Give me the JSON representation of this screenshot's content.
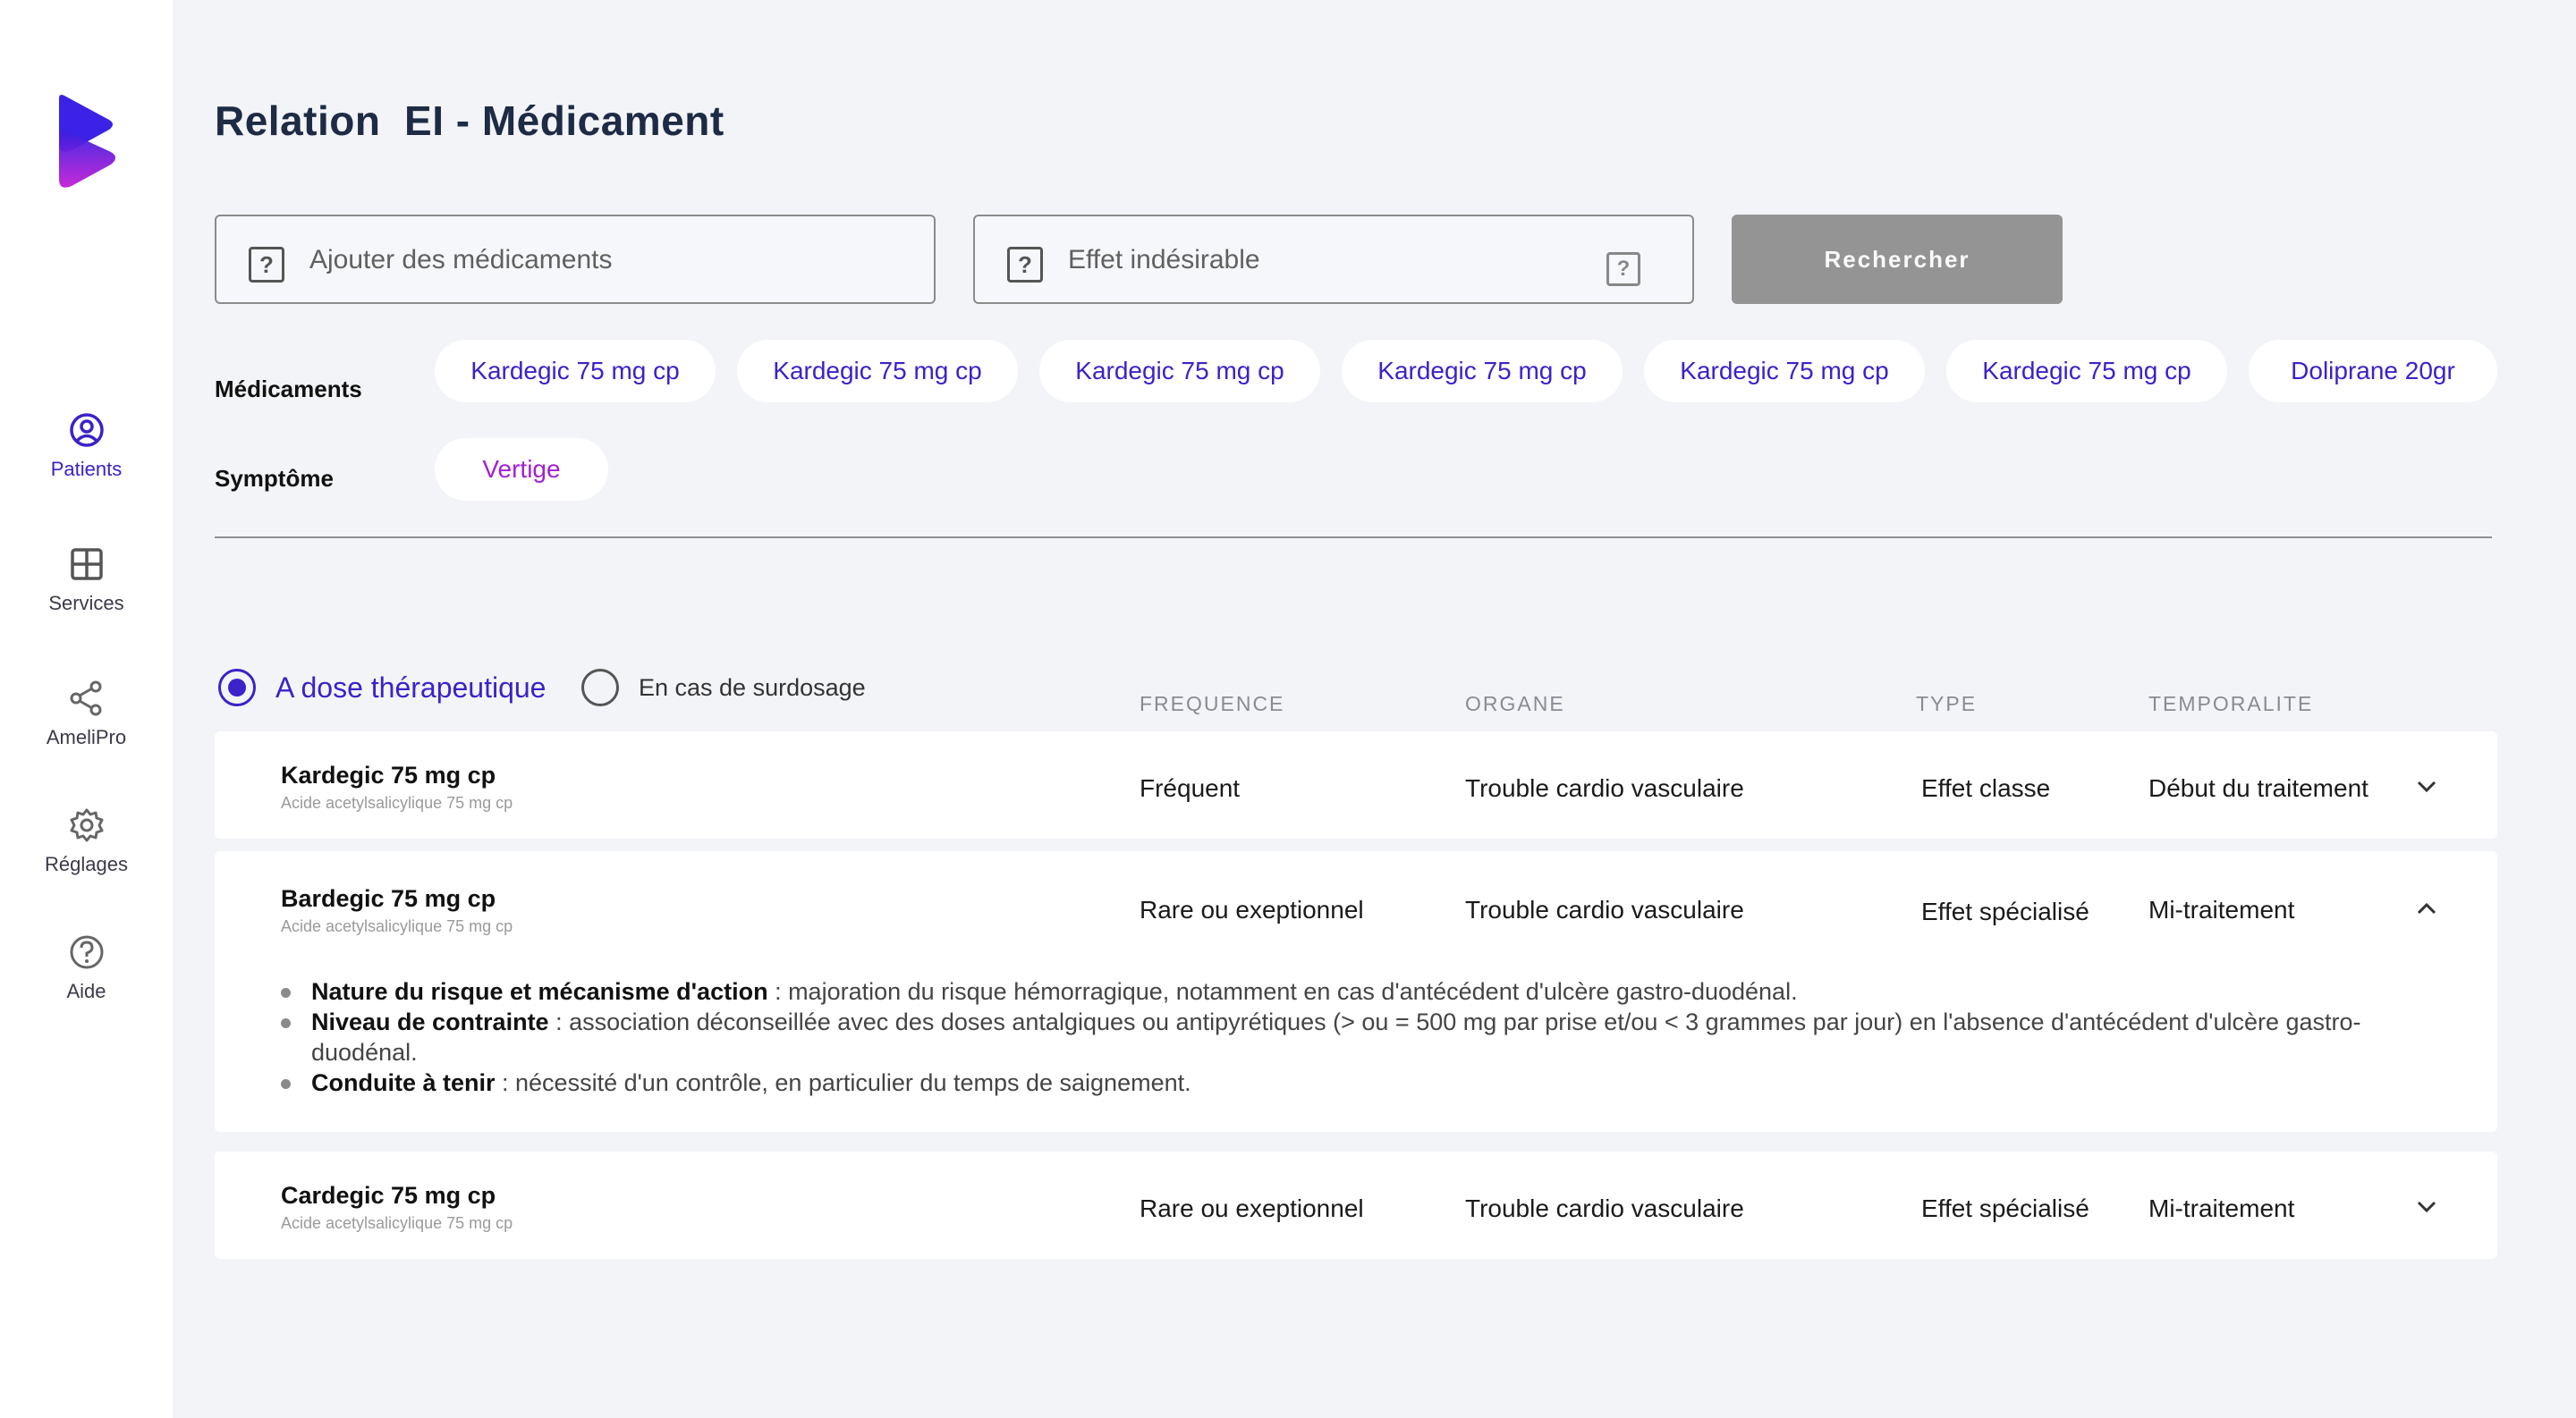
{
  "sidebar": {
    "logo_icon": "brand-logo",
    "items": [
      {
        "label": "Patients",
        "icon": "user-circle-icon",
        "active": true
      },
      {
        "label": "Services",
        "icon": "grid-icon",
        "active": false
      },
      {
        "label": "AmeliPro",
        "icon": "share-icon",
        "active": false
      },
      {
        "label": "Réglages",
        "icon": "gear-icon",
        "active": false
      },
      {
        "label": "Aide",
        "icon": "help-circle-icon",
        "active": false
      }
    ]
  },
  "page": {
    "title": "Relation  EI - Médicament"
  },
  "search": {
    "drug_placeholder": "Ajouter des médicaments",
    "effect_placeholder": "Effet indésirable",
    "help_glyph": "?",
    "button_label": "Rechercher"
  },
  "filters": {
    "drugs_label": "Médicaments",
    "drugs": [
      "Kardegic 75 mg cp",
      "Kardegic 75 mg cp",
      "Kardegic 75 mg cp",
      "Kardegic 75 mg cp",
      "Kardegic 75 mg cp",
      "Kardegic 75 mg cp",
      "Doliprane 20gr"
    ],
    "symptom_label": "Symptôme",
    "symptoms": [
      "Vertige"
    ]
  },
  "dose_options": {
    "therapeutic": "A dose thérapeutique",
    "overdose": "En cas de surdosage",
    "selected": "therapeutic"
  },
  "table": {
    "columns": [
      "FREQUENCE",
      "ORGANE",
      "TYPE",
      "TEMPORALITE"
    ],
    "rows": [
      {
        "name": "Kardegic 75 mg cp",
        "sub": "Acide acetylsalicylique 75 mg cp",
        "frequence": "Fréquent",
        "organe": "Trouble cardio vasculaire",
        "type": "Effet classe",
        "temporalite": "Début du traitement",
        "expanded": false
      },
      {
        "name": "Bardegic 75 mg cp",
        "sub": "Acide acetylsalicylique 75 mg cp",
        "frequence": "Rare ou exeptionnel",
        "organe": "Trouble cardio vasculaire",
        "type": "Effet spécialisé",
        "temporalite": "Mi-traitement",
        "expanded": true,
        "details": [
          {
            "term": "Nature du risque et mécanisme d'action",
            "text": " : majoration du risque hémorragique, notamment en cas d'antécédent d'ulcère gastro-duodénal."
          },
          {
            "term": "Niveau de contrainte",
            "text": " : association déconseillée avec des doses antalgiques ou antipyrétiques (> ou = 500 mg par prise et/ou < 3 grammes par jour) en l'absence d'antécédent d'ulcère gastro-duodénal."
          },
          {
            "term": "Conduite à tenir",
            "text": " : nécessité d'un contrôle, en particulier du temps de saignement."
          }
        ]
      },
      {
        "name": "Cardegic 75 mg cp",
        "sub": "Acide acetylsalicylique 75 mg cp",
        "frequence": "Rare ou exeptionnel",
        "organe": "Trouble cardio vasculaire",
        "type": "Effet spécialisé",
        "temporalite": "Mi-traitement",
        "expanded": false
      }
    ]
  },
  "colors": {
    "accent": "#3b22c9",
    "symptom": "#a31fd1",
    "button_bg": "#949494",
    "background": "#f3f4f8"
  }
}
